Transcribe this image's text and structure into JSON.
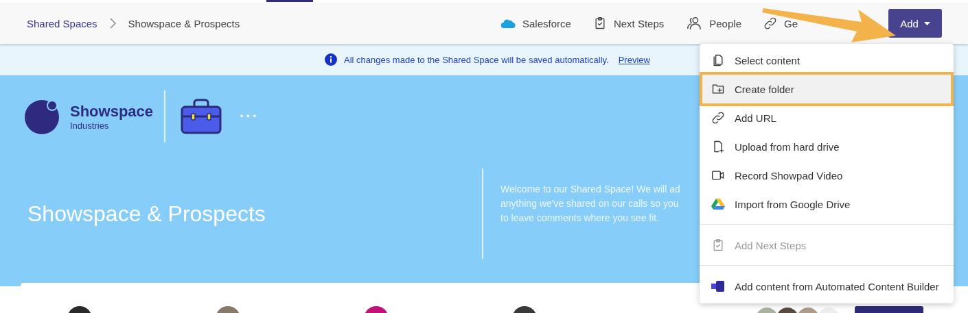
{
  "breadcrumb": [
    {
      "label": "Shared Spaces",
      "kind": "link"
    },
    {
      "label": "Showspace & Prospects",
      "kind": "current"
    }
  ],
  "nav": [
    {
      "label": "Salesforce",
      "kind": "cloud"
    },
    {
      "label": "Next Steps",
      "kind": "clipboard"
    },
    {
      "label": "People",
      "kind": "people"
    },
    {
      "label": "Ge",
      "kind": "link"
    }
  ],
  "add_button": {
    "label": "Add",
    "expanded": true
  },
  "banner": {
    "text": "All changes made to the Shared Space will be saved automatically.",
    "link": "Preview"
  },
  "hero": {
    "brand": "Showspace",
    "brand_sub": "Industries",
    "more": "···",
    "title": "Showspace & Prospects",
    "description": "Welcome to our Shared Space! We will ad anything we've shared on our calls so you to leave comments where you see fit."
  },
  "members": [
    {
      "color": "#2a2a2a"
    },
    {
      "color": "#8a7868"
    },
    {
      "color": "#c2127a"
    },
    {
      "color": "#3a3a3a"
    }
  ],
  "menu": [
    {
      "label": "Select content",
      "kind": "file",
      "selected": false,
      "disabled": false
    },
    {
      "label": "Create folder",
      "kind": "folder",
      "selected": true,
      "disabled": false
    },
    {
      "label": "Add URL",
      "kind": "link",
      "selected": false,
      "disabled": false
    },
    {
      "label": "Upload from hard drive",
      "kind": "upload",
      "selected": false,
      "disabled": false
    },
    {
      "label": "Record Showpad Video",
      "kind": "video",
      "selected": false,
      "disabled": false
    },
    {
      "label": "Import from Google Drive",
      "kind": "drive",
      "selected": false,
      "disabled": false
    },
    {
      "kind": "divider"
    },
    {
      "label": "Add Next Steps",
      "kind": "clipboard",
      "selected": false,
      "disabled": true
    },
    {
      "kind": "divider"
    },
    {
      "label": "Add content from Automated Content Builder",
      "kind": "builder",
      "selected": false,
      "disabled": false
    }
  ]
}
